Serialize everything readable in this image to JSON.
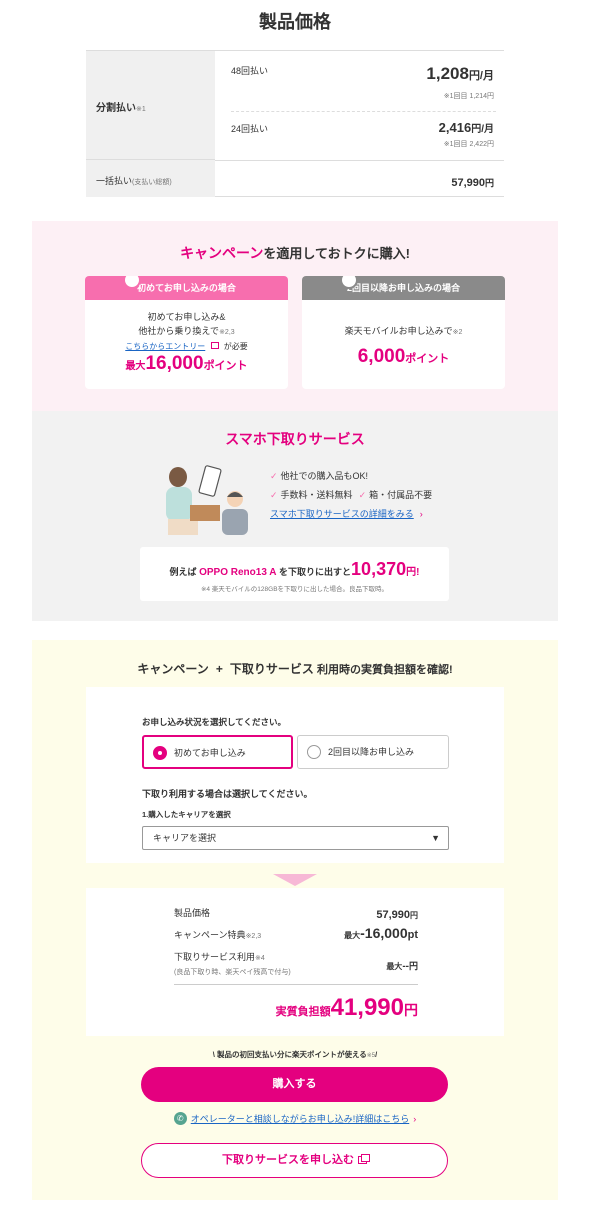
{
  "page_title": "製品価格",
  "price_table": {
    "installment_label": "分割払い",
    "installment_note": "※1",
    "plan48": {
      "label": "48回払い",
      "amount": "1,208",
      "unit": "円/月",
      "note": "※1回目 1,214円"
    },
    "plan24": {
      "label": "24回払い",
      "amount": "2,416",
      "unit": "円/月",
      "note": "※1回目 2,422円"
    },
    "lump_label": "一括払い",
    "lump_note": "(支払い総額)",
    "lump_amount": "57,990",
    "lump_unit": "円"
  },
  "campaign": {
    "title_pink": "キャンペーン",
    "title_rest": "を適用しておトクに購入!",
    "card1": {
      "header": "初めてお申し込みの場合",
      "line1": "初めてお申し込み&",
      "line2": "他社から乗り換えで",
      "line2_note": "※2,3",
      "link": "こちらからエントリー",
      "link_suffix": "が必要",
      "pts_prefix": "最大",
      "pts_value": "16,000",
      "pts_unit": "ポイント"
    },
    "card2": {
      "header": "2回目以降お申し込みの場合",
      "line1": "楽天モバイルお申し込みで",
      "line1_note": "※2",
      "pts_value": "6,000",
      "pts_unit": "ポイント"
    }
  },
  "tradein": {
    "title": "スマホ下取りサービス",
    "point1": "他社での購入品もOK!",
    "point2": "手数料・送料無料",
    "point3": "箱・付属品不要",
    "link": "スマホ下取りサービスの詳細をみる",
    "example_prefix": "例えば",
    "example_model": "OPPO Reno13 A",
    "example_mid": "を下取りに出すと",
    "example_value": "10,370",
    "example_unit": "円!",
    "example_note": "※4 楽天モバイルの128GBを下取りに出した場合。良品下取時。"
  },
  "simulator": {
    "title_a": "キャンペーン",
    "title_plus": "+",
    "title_b": "下取りサービス",
    "title_rest": "利用時の実質負担額を確認!",
    "q1": "お申し込み状況を選択してください。",
    "option1": "初めてお申し込み",
    "option2": "2回目以降お申し込み",
    "q2": "下取り利用する場合は選択してください。",
    "carrier_label": "1.購入したキャリアを選択",
    "carrier_value": "キャリアを選択",
    "result": {
      "price_label": "製品価格",
      "price_value": "57,990",
      "price_unit": "円",
      "campaign_label": "キャンペーン特典",
      "campaign_note": "※2,3",
      "campaign_prefix": "最大",
      "campaign_value": "-16,000",
      "campaign_unit": "pt",
      "tradein_label": "下取りサービス利用",
      "tradein_note": "※4",
      "tradein_sub": "(良品下取り時、楽天ペイ残高で付与)",
      "tradein_prefix": "最大",
      "tradein_value": "--",
      "tradein_unit": "円",
      "total_label": "実質負担額",
      "total_value": "41,990",
      "total_unit": "円"
    },
    "payment_note": "\\ 製品の初回支払い分に楽天ポイントが使える",
    "payment_note_ref": "※5",
    "payment_note_end": "/",
    "buy_button": "購入する",
    "operator_link": "オペレーターと相談しながらお申し込み!詳細はこちら",
    "apply_button": "下取りサービスを申し込む"
  },
  "colors": {
    "brand_pink": "#e4007f",
    "link_blue": "#1a65c4",
    "campaign_bg": "#fdf0f5",
    "tradein_bg": "#f2f2f2",
    "sim_bg": "#fefde9"
  }
}
